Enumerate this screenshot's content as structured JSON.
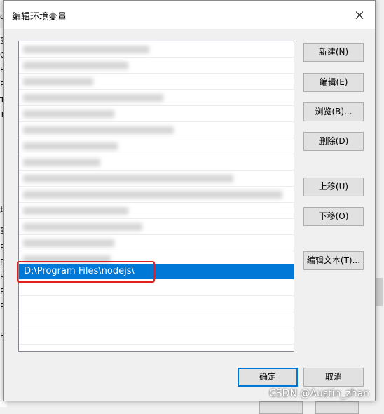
{
  "dialog": {
    "title": "编辑环境变量"
  },
  "list": {
    "selected_item": "D:\\Program Files\\nodejs\\"
  },
  "buttons": {
    "new": "新建(N)",
    "edit": "编辑(E)",
    "browse": "浏览(B)...",
    "delete": "删除(D)",
    "move_up": "上移(U)",
    "move_down": "下移(O)",
    "edit_text": "编辑文本(T)...",
    "ok": "确定",
    "cancel": "取消"
  },
  "background": {
    "fragments": [
      "c",
      "变",
      "O",
      "Pa",
      "Py",
      "TE",
      "TN",
      "境",
      "变",
      "Pa",
      "PA",
      "PF",
      "PF",
      "PF",
      "PS"
    ]
  },
  "watermark": "CSDN @Austin_zhan",
  "colors": {
    "selection": "#0078d7",
    "highlight_box": "#e02020"
  }
}
